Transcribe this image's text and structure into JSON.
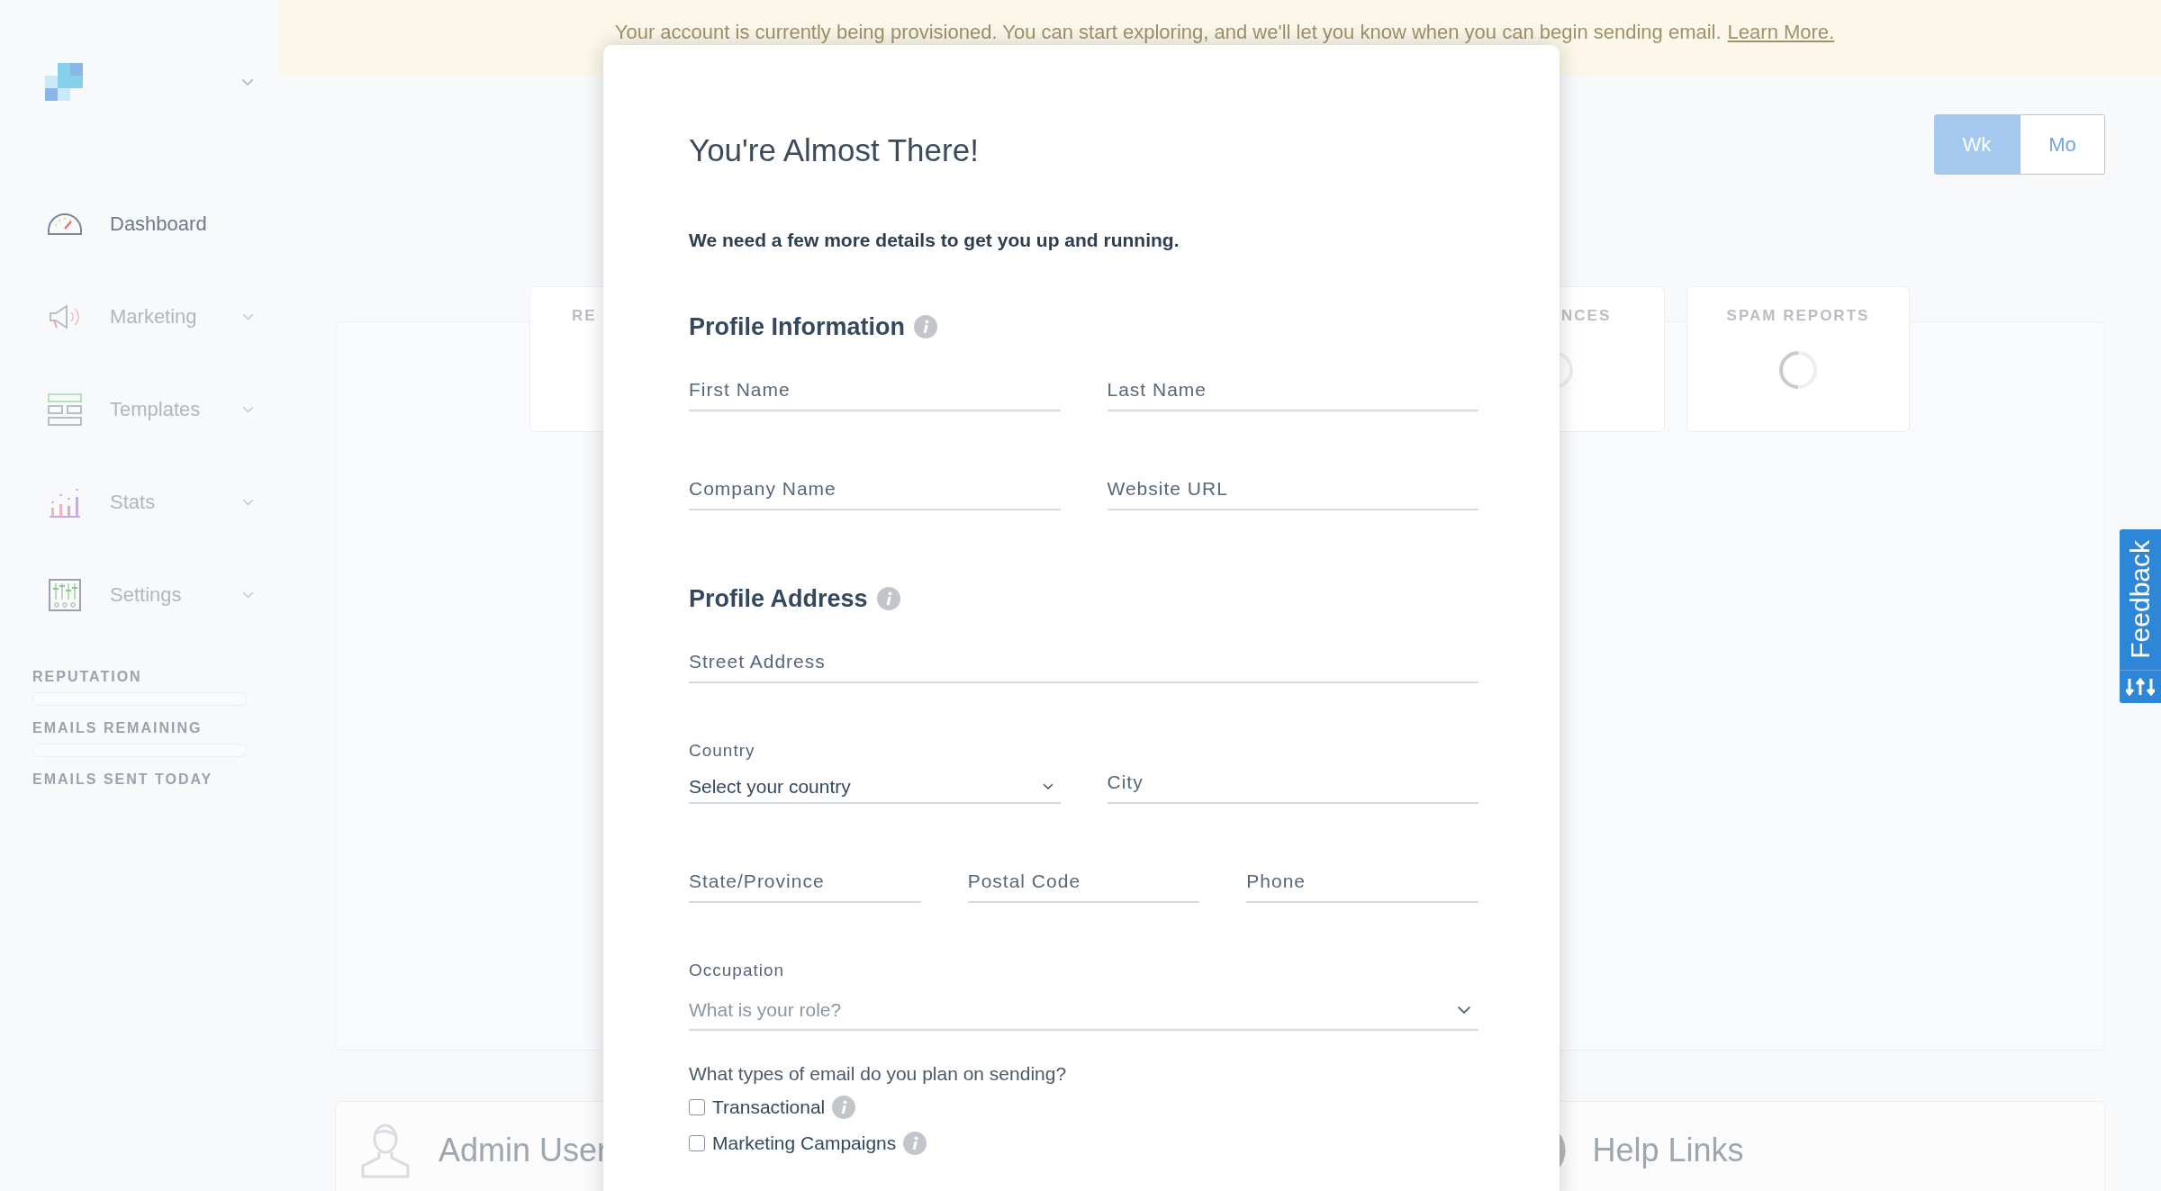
{
  "banner": {
    "message": "Your account is currently being provisioned. You can start exploring, and we'll let you know when you can begin sending email.",
    "link": "Learn More."
  },
  "sidebar": {
    "items": [
      {
        "label": "Dashboard",
        "selected": true,
        "expandable": false
      },
      {
        "label": "Marketing",
        "selected": false,
        "expandable": true
      },
      {
        "label": "Templates",
        "selected": false,
        "expandable": true
      },
      {
        "label": "Stats",
        "selected": false,
        "expandable": true
      },
      {
        "label": "Settings",
        "selected": false,
        "expandable": true
      }
    ],
    "meters": [
      {
        "label": "REPUTATION",
        "kind": "bar"
      },
      {
        "label": "EMAILS REMAINING",
        "kind": "bar"
      },
      {
        "label": "EMAILS SENT TODAY",
        "kind": "text"
      }
    ]
  },
  "range_toggle": [
    {
      "label": "Wk",
      "selected": true
    },
    {
      "label": "Mo",
      "selected": false
    }
  ],
  "stat_cards": [
    {
      "title": "RE",
      "loading": false
    },
    {
      "title": "NCES",
      "loading": true
    },
    {
      "title": "SPAM REPORTS",
      "loading": true
    }
  ],
  "bottom_cards": [
    {
      "title": "Admin User",
      "kind": "user"
    },
    {
      "title": "Help Links",
      "kind": "help"
    }
  ],
  "feedback_tab": {
    "label": "Feedback"
  },
  "modal": {
    "title": "You're Almost There!",
    "subtitle": "We need a few more details to get you up and running.",
    "sections": [
      {
        "heading": "Profile Information",
        "rows": [
          [
            {
              "kind": "input",
              "placeholder": "First Name"
            },
            {
              "kind": "input",
              "placeholder": "Last Name"
            }
          ],
          [
            {
              "kind": "input",
              "placeholder": "Company Name"
            },
            {
              "kind": "input",
              "placeholder": "Website URL"
            }
          ]
        ]
      },
      {
        "heading": "Profile Address",
        "rows": [
          [
            {
              "kind": "input",
              "placeholder": "Street Address"
            }
          ],
          [
            {
              "kind": "select",
              "label": "Country",
              "value": "Select your country"
            },
            {
              "kind": "input",
              "placeholder": "City"
            }
          ],
          [
            {
              "kind": "input",
              "placeholder": "State/Province"
            },
            {
              "kind": "input",
              "placeholder": "Postal Code"
            },
            {
              "kind": "input",
              "placeholder": "Phone"
            }
          ],
          [
            {
              "kind": "select",
              "label": "Occupation",
              "placeholder": "What is your role?"
            }
          ]
        ]
      }
    ],
    "email_types": {
      "question": "What types of email do you plan on sending?",
      "options": [
        {
          "label": "Transactional",
          "checked": false
        },
        {
          "label": "Marketing Campaigns",
          "checked": false
        }
      ]
    }
  }
}
